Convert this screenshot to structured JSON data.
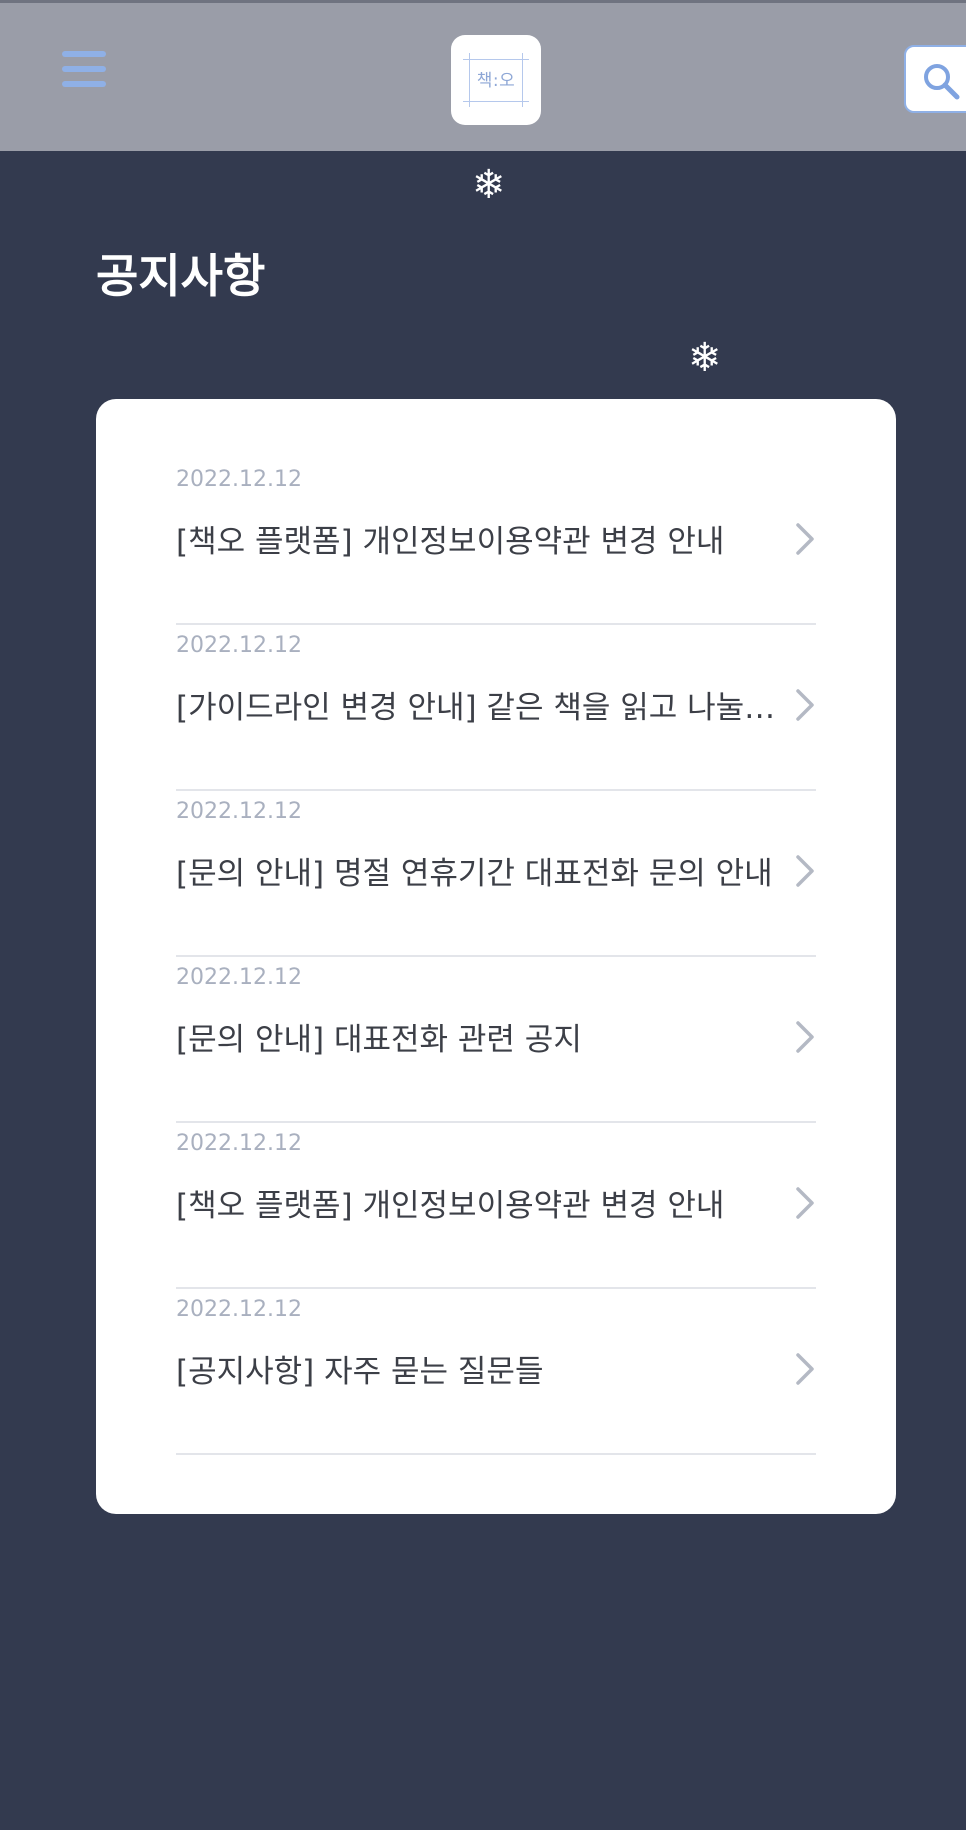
{
  "header": {
    "logo_text": "책:오",
    "menu_icon": "hamburger-menu-icon",
    "search_icon": "search-icon"
  },
  "decor": {
    "snowflake": "❄"
  },
  "page": {
    "title": "공지사항"
  },
  "notices": [
    {
      "date": "2022.12.12",
      "title": "[책오 플랫폼] 개인정보이용약관 변경 안내"
    },
    {
      "date": "2022.12.12",
      "title": "[가이드라인 변경 안내] 같은 책을 읽고 나눌 …"
    },
    {
      "date": "2022.12.12",
      "title": "[문의 안내] 명절 연휴기간 대표전화 문의 안내"
    },
    {
      "date": "2022.12.12",
      "title": "[문의 안내] 대표전화 관련 공지"
    },
    {
      "date": "2022.12.12",
      "title": "[책오 플랫폼] 개인정보이용약관 변경 안내"
    },
    {
      "date": "2022.12.12",
      "title": "[공지사항] 자주 묻는 질문들"
    }
  ],
  "colors": {
    "background": "#333a4f",
    "header": "#9a9da8",
    "accent": "#8fb0e6",
    "date_text": "#a9b0bf",
    "title_text": "#3c3f47"
  }
}
